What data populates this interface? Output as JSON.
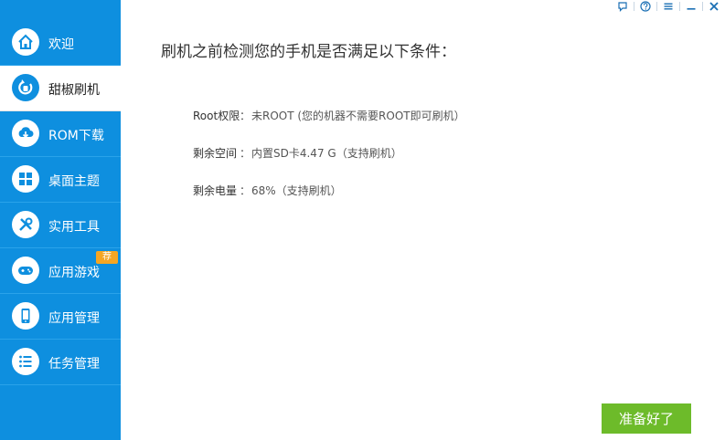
{
  "sidebar": {
    "items": [
      {
        "label": "欢迎",
        "icon": "home-icon"
      },
      {
        "label": "甜椒刷机",
        "icon": "refresh-flash-icon"
      },
      {
        "label": "ROM下载",
        "icon": "cloud-download-icon"
      },
      {
        "label": "桌面主题",
        "icon": "grid-theme-icon"
      },
      {
        "label": "实用工具",
        "icon": "tools-icon"
      },
      {
        "label": "应用游戏",
        "icon": "gamepad-icon",
        "badge": "荐"
      },
      {
        "label": "应用管理",
        "icon": "phone-icon"
      },
      {
        "label": "任务管理",
        "icon": "list-icon"
      }
    ],
    "active_index": 1,
    "color": "#0e8fdf"
  },
  "window_controls": {
    "icons": [
      "chat-icon",
      "help-icon",
      "menu-icon",
      "minimize-icon",
      "close-icon"
    ]
  },
  "main": {
    "title": "刷机之前检测您的手机是否满足以下条件：",
    "conditions": [
      {
        "label": "Root权限",
        "colon": "：",
        "value": "未ROOT (您的机器不需要ROOT即可刷机）"
      },
      {
        "label": "剩余空间",
        "colon": "：",
        "value": "内置SD卡4.47 G（支持刷机）"
      },
      {
        "label": "剩余电量",
        "colon": "：",
        "value": "68%（支持刷机）"
      }
    ],
    "ready_button": "准备好了",
    "ready_button_color": "#6dbb2a"
  }
}
